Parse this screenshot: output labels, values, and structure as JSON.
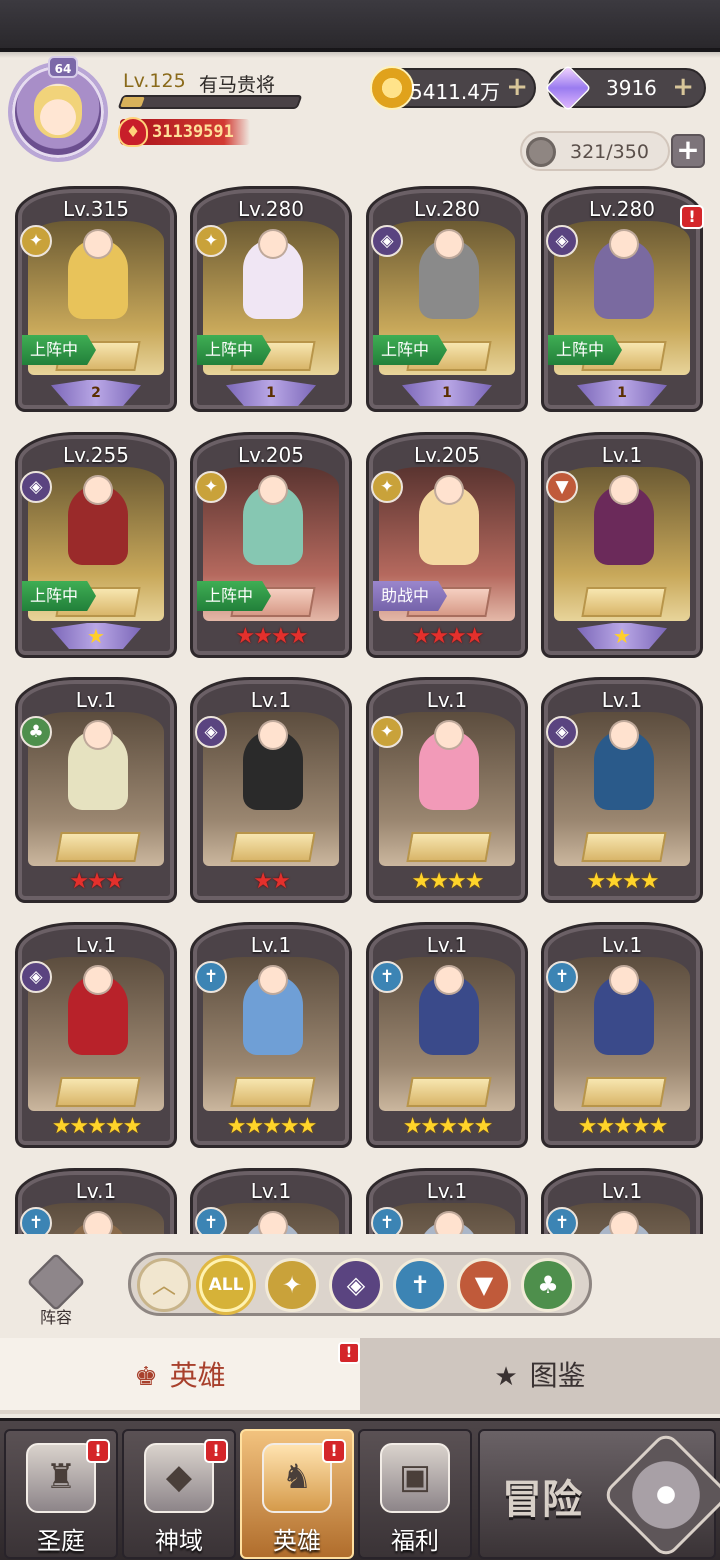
{
  "player": {
    "avatar_badge": "64",
    "level": "Lv.125",
    "name": "有马贵将",
    "exp_fraction": 0.12,
    "power": "31139591"
  },
  "resources": {
    "gold": "5411.4万",
    "gems": "3916",
    "capacity": "321/350",
    "plus_symbol": "+"
  },
  "heroes": [
    {
      "level": "Lv.315",
      "faction": "light",
      "status": "上阵中",
      "stars": "2",
      "star_type": "wing-number",
      "bg": "gold",
      "alert": false
    },
    {
      "level": "Lv.280",
      "faction": "light",
      "status": "上阵中",
      "stars": "1",
      "star_type": "wing-number",
      "bg": "gold",
      "alert": false
    },
    {
      "level": "Lv.280",
      "faction": "dark",
      "status": "上阵中",
      "stars": "1",
      "star_type": "wing-number",
      "bg": "gold",
      "alert": false
    },
    {
      "level": "Lv.280",
      "faction": "dark",
      "status": "上阵中",
      "stars": "1",
      "star_type": "wing-number",
      "bg": "gold",
      "alert": true
    },
    {
      "level": "Lv.255",
      "faction": "dark",
      "status": "上阵中",
      "stars": "★",
      "star_type": "wing-gold",
      "bg": "gold",
      "alert": false
    },
    {
      "level": "Lv.205",
      "faction": "light",
      "status": "上阵中",
      "stars": "★★★★",
      "star_type": "red",
      "bg": "red",
      "alert": false
    },
    {
      "level": "Lv.205",
      "faction": "light",
      "status": "助战中",
      "stars": "★★★★",
      "star_type": "red",
      "bg": "red",
      "alert": false
    },
    {
      "level": "Lv.1",
      "faction": "beast",
      "status": "",
      "stars": "★",
      "star_type": "wing-gold",
      "bg": "gold",
      "alert": false
    },
    {
      "level": "Lv.1",
      "faction": "nature",
      "status": "",
      "stars": "★★★",
      "star_type": "red",
      "bg": "brown",
      "alert": false
    },
    {
      "level": "Lv.1",
      "faction": "dark",
      "status": "",
      "stars": "★★",
      "star_type": "red",
      "bg": "brown",
      "alert": false
    },
    {
      "level": "Lv.1",
      "faction": "light",
      "status": "",
      "stars": "★★★★",
      "star_type": "yellow",
      "bg": "brown",
      "alert": false
    },
    {
      "level": "Lv.1",
      "faction": "dark",
      "status": "",
      "stars": "★★★★",
      "star_type": "yellow",
      "bg": "brown",
      "alert": false
    },
    {
      "level": "Lv.1",
      "faction": "dark",
      "status": "",
      "stars": "★★★★★",
      "star_type": "yellow",
      "bg": "brown",
      "alert": false
    },
    {
      "level": "Lv.1",
      "faction": "holy",
      "status": "",
      "stars": "★★★★★",
      "star_type": "yellow",
      "bg": "brown",
      "alert": false
    },
    {
      "level": "Lv.1",
      "faction": "holy",
      "status": "",
      "stars": "★★★★★",
      "star_type": "yellow",
      "bg": "brown",
      "alert": false
    },
    {
      "level": "Lv.1",
      "faction": "holy",
      "status": "",
      "stars": "★★★★★",
      "star_type": "yellow",
      "bg": "brown",
      "alert": false
    },
    {
      "level": "Lv.1",
      "faction": "holy",
      "status": "",
      "stars": "",
      "star_type": "none",
      "bg": "brown",
      "alert": false
    },
    {
      "level": "Lv.1",
      "faction": "holy",
      "status": "",
      "stars": "",
      "star_type": "none",
      "bg": "brown",
      "alert": false
    },
    {
      "level": "Lv.1",
      "faction": "holy",
      "status": "",
      "stars": "",
      "star_type": "none",
      "bg": "brown",
      "alert": false
    },
    {
      "level": "Lv.1",
      "faction": "holy",
      "status": "",
      "stars": "",
      "star_type": "none",
      "bg": "brown",
      "alert": false
    }
  ],
  "filter": {
    "lineup_label": "阵容",
    "all_label": "ALL",
    "factions": [
      "up-chevron",
      "all",
      "light",
      "dark",
      "holy",
      "beast",
      "nature"
    ]
  },
  "sub_tabs": {
    "hero": "英雄",
    "codex": "图鉴",
    "alert": "!"
  },
  "bottom_nav": {
    "items": [
      {
        "label": "圣庭",
        "icon": "castle-icon",
        "alert": true,
        "active": false
      },
      {
        "label": "神域",
        "icon": "crystal-icon",
        "alert": true,
        "active": false
      },
      {
        "label": "英雄",
        "icon": "helmet-icon",
        "alert": true,
        "active": true
      },
      {
        "label": "福利",
        "icon": "chest-icon",
        "alert": false,
        "active": false
      }
    ],
    "adventure": "冒险"
  },
  "colors": {
    "accent_gold": "#d6b238",
    "alert_red": "#d4262a",
    "active_tab": "#a8402c"
  }
}
